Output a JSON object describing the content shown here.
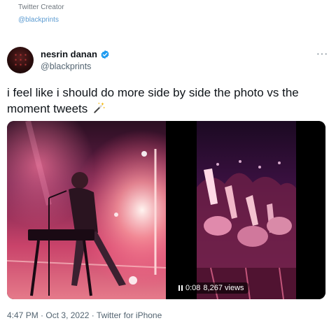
{
  "header": {
    "label": "Twitter Creator",
    "handle": "@blackprints"
  },
  "tweet": {
    "display_name": "nesrin danan",
    "handle": "@blackprints",
    "more_label": "···",
    "text": "i feel like i should do more side by side the photo vs the moment tweets",
    "media": {
      "video_time": "0:08",
      "video_views": "8,267 views"
    },
    "footer": {
      "time": "4:47 PM",
      "date": "Oct 3, 2022",
      "source": "Twitter for iPhone",
      "separator": "·"
    }
  },
  "colors": {
    "link": "#5b9bd1",
    "verified": "#1d9bf0",
    "secondary_text": "#536471"
  },
  "icons": {
    "verified": "verified-badge-icon",
    "sparkle": "magic-wand-icon",
    "more": "more-icon",
    "pause": "pause-icon"
  }
}
